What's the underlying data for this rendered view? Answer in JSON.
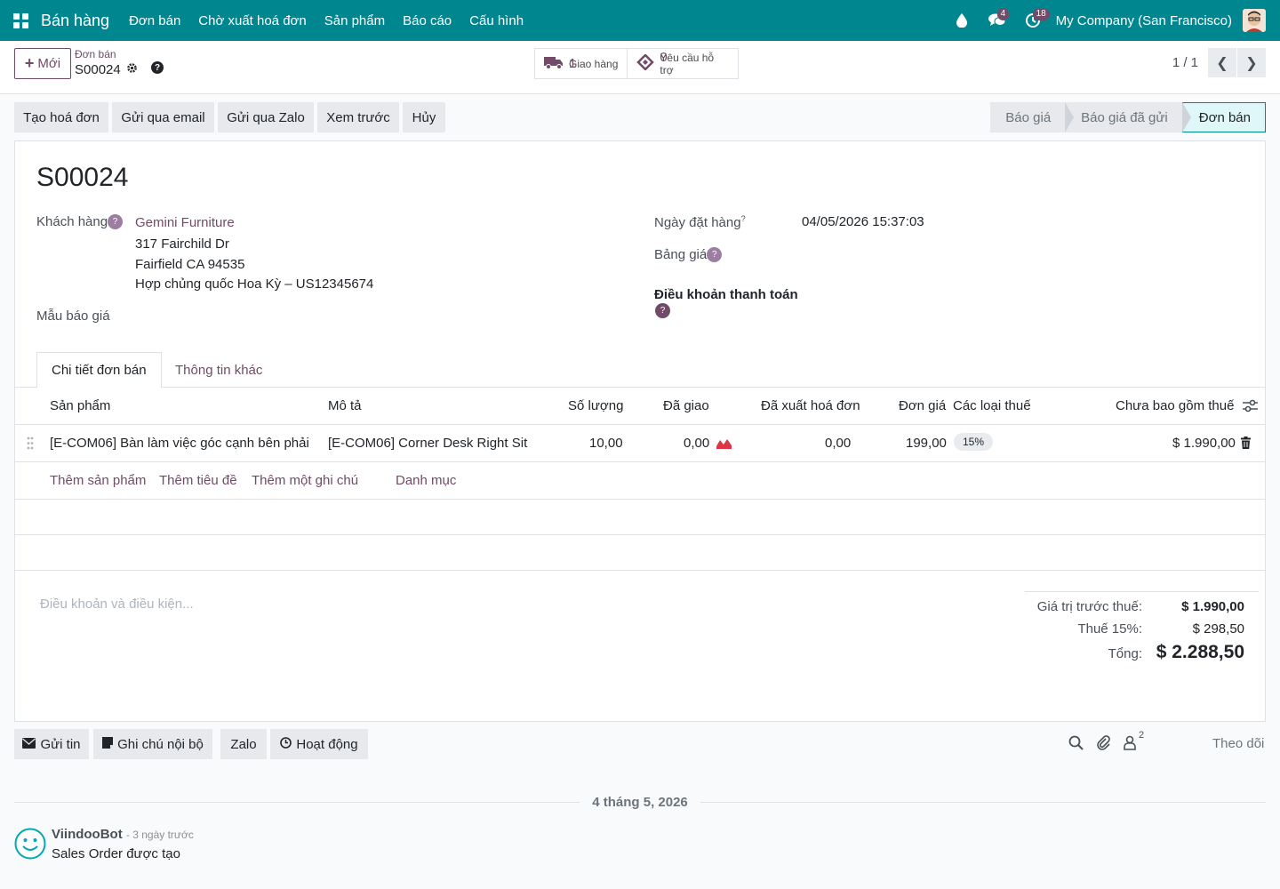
{
  "navbar": {
    "brand": "Bán hàng",
    "menu": [
      "Đơn bán",
      "Chờ xuất hoá đơn",
      "Sản phẩm",
      "Báo cáo",
      "Cấu hình"
    ],
    "messages_count": "4",
    "activities_count": "18",
    "company": "My Company (San Francisco)"
  },
  "control": {
    "new_label": "Mới",
    "breadcrumb_parent": "Đơn bán",
    "breadcrumb_current": "S00024",
    "smart_buttons": [
      {
        "label": "Giao hàng",
        "value": "1",
        "icon": "truck-icon"
      },
      {
        "label": "Yêu cầu hỗ trợ",
        "value": "0",
        "icon": "ticket-icon"
      }
    ],
    "pager": "1 / 1"
  },
  "actions": [
    "Tạo hoá đơn",
    "Gửi qua email",
    "Gửi qua Zalo",
    "Xem trước",
    "Hủy"
  ],
  "stages": [
    "Báo giá",
    "Báo giá đã gửi",
    "Đơn bán"
  ],
  "form": {
    "name": "S00024",
    "customer_label": "Khách hàng",
    "customer_name": "Gemini Furniture",
    "address": [
      "317 Fairchild Dr",
      "Fairfield CA 94535",
      "Hợp chủng quốc Hoa Kỳ – US12345674"
    ],
    "quote_template_label": "Mẫu báo giá",
    "order_date_label": "Ngày đặt hàng",
    "order_date": "04/05/2026 15:37:03",
    "pricelist_label": "Bảng giá",
    "payment_terms_label": "Điều khoản thanh toán"
  },
  "tabs": [
    "Chi tiết đơn bán",
    "Thông tin khác"
  ],
  "table": {
    "headers": [
      "Sản phẩm",
      "Mô tả",
      "Số lượng",
      "Đã giao",
      "Đã xuất hoá đơn",
      "Đơn giá",
      "Các loại thuế",
      "Chưa bao gồm thuế"
    ],
    "rows": [
      {
        "product": "[E-COM06] Bàn làm việc góc cạnh bên phải",
        "description": "[E-COM06] Corner Desk Right Sit",
        "qty": "10,00",
        "delivered": "0,00",
        "invoiced": "0,00",
        "price": "199,00",
        "tax": "15%",
        "subtotal": "$ 1.990,00"
      }
    ],
    "add_links": [
      "Thêm sản phẩm",
      "Thêm tiêu đề",
      "Thêm một ghi chú",
      "Danh mục"
    ]
  },
  "terms_placeholder": "Điều khoản và điều kiện...",
  "totals": {
    "untaxed_label": "Giá trị trước thuế:",
    "untaxed": "$ 1.990,00",
    "tax_label": "Thuế 15%:",
    "tax": "$ 298,50",
    "total_label": "Tổng:",
    "total": "$ 2.288,50"
  },
  "chatter": {
    "buttons": [
      "Gửi tin",
      "Ghi chú nội bộ",
      "Zalo",
      "Hoạt động"
    ],
    "followers_count": "2",
    "follow_label": "Theo dõi",
    "date_separator": "4 tháng 5, 2026",
    "author": "ViindooBot",
    "time": "- 3 ngày trước",
    "message": "Sales Order được tạo"
  },
  "colors": {
    "navbar": "#00868f",
    "primary": "#714b67",
    "stage_active_bg": "#e0f7fa"
  }
}
